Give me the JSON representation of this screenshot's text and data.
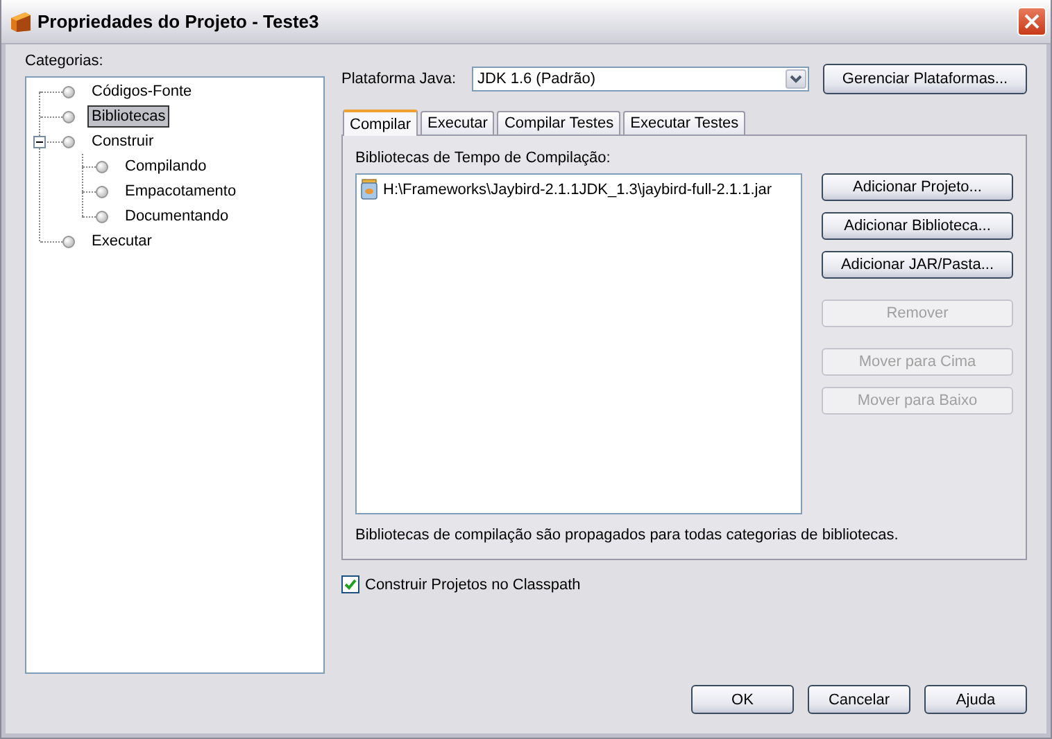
{
  "window": {
    "title": "Propriedades do Projeto - Teste3"
  },
  "categories": {
    "label": "Categorias:",
    "items": [
      {
        "label": "Códigos-Fonte",
        "selected": false
      },
      {
        "label": "Bibliotecas",
        "selected": true
      },
      {
        "label": "Construir",
        "selected": false,
        "expanded": true,
        "children": [
          {
            "label": "Compilando",
            "selected": false
          },
          {
            "label": "Empacotamento",
            "selected": false
          },
          {
            "label": "Documentando",
            "selected": false
          }
        ]
      },
      {
        "label": "Executar",
        "selected": false
      }
    ]
  },
  "platform": {
    "label": "Plataforma Java:",
    "value": "JDK 1.6 (Padrão)",
    "manage_button": "Gerenciar Plataformas..."
  },
  "tabs": [
    {
      "label": "Compilar",
      "selected": true
    },
    {
      "label": "Executar",
      "selected": false
    },
    {
      "label": "Compilar Testes",
      "selected": false
    },
    {
      "label": "Executar Testes",
      "selected": false
    }
  ],
  "libraries": {
    "label": "Bibliotecas de Tempo de Compilação:",
    "items": [
      {
        "path": "H:\\Frameworks\\Jaybird-2.1.1JDK_1.3\\jaybird-full-2.1.1.jar"
      }
    ],
    "button_groups": [
      [
        {
          "label": "Adicionar Projeto...",
          "disabled": false
        },
        {
          "label": "Adicionar Biblioteca...",
          "disabled": false
        },
        {
          "label": "Adicionar JAR/Pasta...",
          "disabled": false
        }
      ],
      [
        {
          "label": "Remover",
          "disabled": true
        }
      ],
      [
        {
          "label": "Mover para Cima",
          "disabled": true
        },
        {
          "label": "Mover para Baixo",
          "disabled": true
        }
      ]
    ],
    "note": "Bibliotecas de compilação são propagados para todas categorias de bibliotecas."
  },
  "build_projects": {
    "label": "Construir Projetos no Classpath",
    "checked": true
  },
  "buttons": [
    "OK",
    "Cancelar",
    "Ajuda"
  ]
}
